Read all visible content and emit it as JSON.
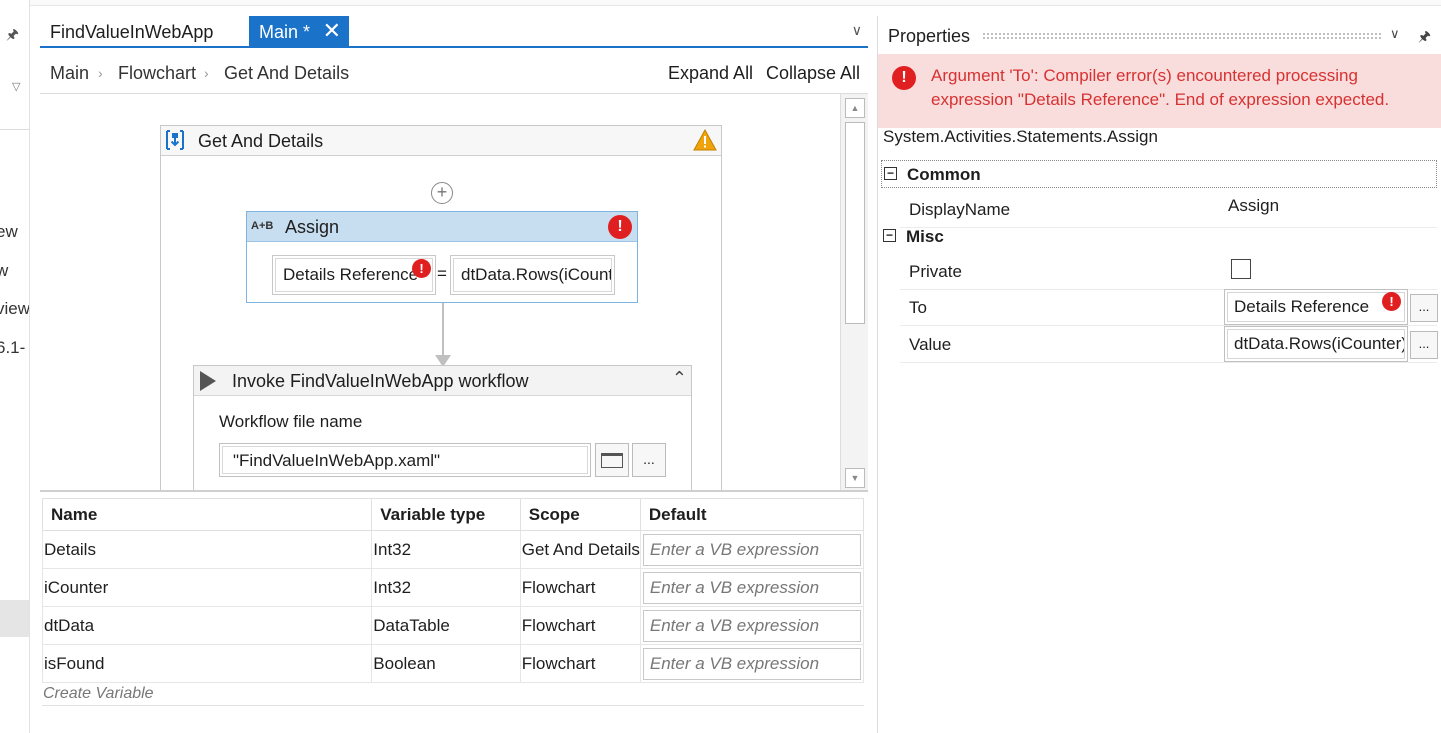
{
  "left_panel": {
    "fragments": [
      "ew",
      "w",
      "view",
      "6.1-"
    ]
  },
  "designer": {
    "tabs": [
      {
        "label": "FindValueInWebApp",
        "active": false
      },
      {
        "label": "Main *",
        "active": true
      }
    ],
    "breadcrumb": [
      "Main",
      "Flowchart",
      "Get And Details"
    ],
    "expand_all": "Expand All",
    "collapse_all": "Collapse All",
    "sequence": {
      "title": "Get And Details"
    },
    "assign": {
      "icon_text": "A+B",
      "title": "Assign",
      "to": "Details Reference",
      "equals": "=",
      "value": "dtData.Rows(iCounter)"
    },
    "invoke": {
      "title": "Invoke FindValueInWebApp workflow",
      "file_label": "Workflow file name",
      "file_value": "\"FindValueInWebApp.xaml\"",
      "dots": "..."
    }
  },
  "variables": {
    "headers": [
      "Name",
      "Variable type",
      "Scope",
      "Default"
    ],
    "rows": [
      {
        "name": "Details",
        "type": "Int32",
        "scope": "Get And Details",
        "default": "Enter a VB expression"
      },
      {
        "name": "iCounter",
        "type": "Int32",
        "scope": "Flowchart",
        "default": "Enter a VB expression"
      },
      {
        "name": "dtData",
        "type": "DataTable",
        "scope": "Flowchart",
        "default": "Enter a VB expression"
      },
      {
        "name": "isFound",
        "type": "Boolean",
        "scope": "Flowchart",
        "default": "Enter a VB expression"
      }
    ],
    "create": "Create Variable"
  },
  "properties": {
    "title": "Properties",
    "error": "Argument 'To': Compiler error(s) encountered processing expression \"Details Reference\". End of expression expected.",
    "type_name": "System.Activities.Statements.Assign",
    "common_label": "Common",
    "misc_label": "Misc",
    "display_name_label": "DisplayName",
    "display_name_value": "Assign",
    "private_label": "Private",
    "to_label": "To",
    "to_value": "Details Reference",
    "value_label": "Value",
    "value_value": "dtData.Rows(iCounter)",
    "dots": "..."
  },
  "colors": {
    "accent": "#1a73c8",
    "error": "#e02020",
    "error_bg": "#f9dcdc",
    "warning": "#f0a30a"
  }
}
